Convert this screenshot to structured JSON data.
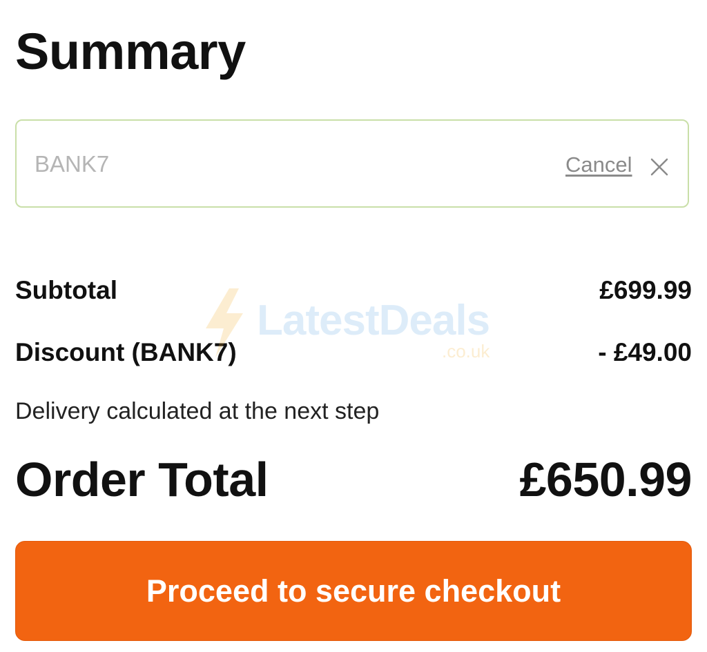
{
  "summary": {
    "title": "Summary"
  },
  "promo": {
    "code_value": "BANK7",
    "cancel_label": "Cancel",
    "close_icon": "close-icon"
  },
  "totals": {
    "subtotal_label": "Subtotal",
    "subtotal_value": "£699.99",
    "discount_label": "Discount (BANK7)",
    "discount_value": "- £49.00",
    "delivery_note": "Delivery calculated at the next step",
    "order_total_label": "Order Total",
    "order_total_value": "£650.99"
  },
  "checkout": {
    "button_label": "Proceed to secure checkout"
  },
  "watermark": {
    "name": "LatestDeals",
    "domain": ".co.uk",
    "icon": "lightning-bolt-icon"
  },
  "colors": {
    "accent": "#f26411",
    "input_border": "#c9dfa8",
    "placeholder_text": "#b5b5b5",
    "cancel_text": "#8a8a8a"
  }
}
